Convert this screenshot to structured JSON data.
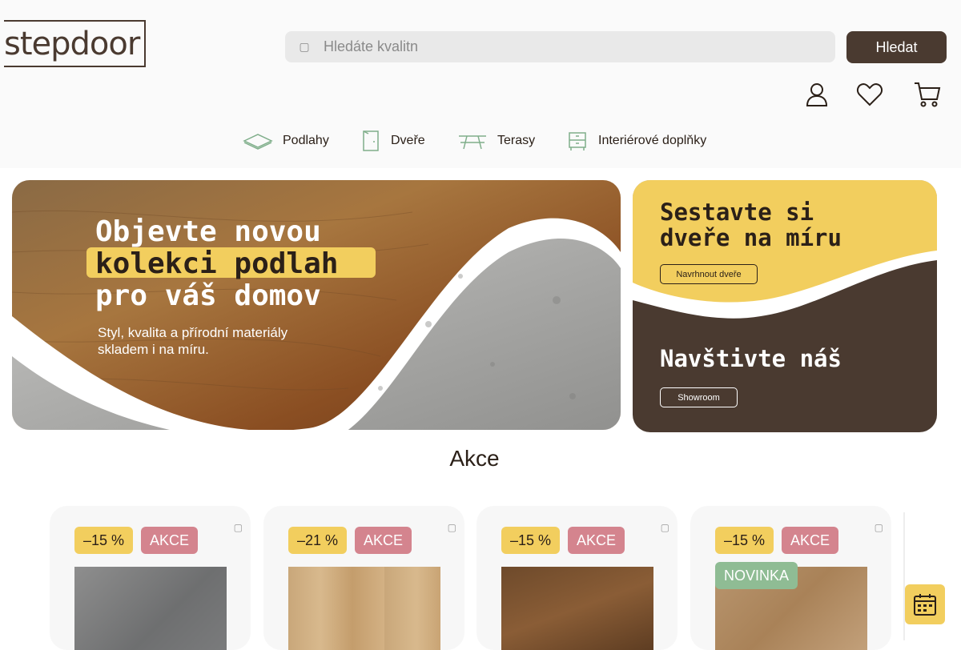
{
  "header": {
    "logo_text": "stepdoor",
    "search": {
      "placeholder": "Hledáte kvalitn",
      "icon": "search-icon"
    },
    "search_button": "Hledat",
    "icons": [
      "user-icon",
      "heart-icon",
      "cart-icon"
    ]
  },
  "nav": [
    {
      "label": "Podlahy",
      "icon": "floor-icon"
    },
    {
      "label": "Dveře",
      "icon": "door-icon"
    },
    {
      "label": "Terasy",
      "icon": "terrace-icon"
    },
    {
      "label": "Interiérové doplňky",
      "icon": "cabinet-icon"
    }
  ],
  "banner_left": {
    "line1": "Objevte novou",
    "line2": "kolekci podlah",
    "line3": "pro váš domov",
    "sub1": "Styl, kvalita a přírodní materiály",
    "sub2": "skladem i na míru."
  },
  "banner_right": {
    "top_line1": "Sestavte si",
    "top_line2": "dveře na míru",
    "top_button": "Navrhnout dveře",
    "bottom_title": "Navštivte náš",
    "bottom_button": "Showroom"
  },
  "section": {
    "title": "Akce"
  },
  "products": [
    {
      "discount": "–15 %",
      "tag": "AKCE",
      "extra": ""
    },
    {
      "discount": "–21 %",
      "tag": "AKCE",
      "extra": ""
    },
    {
      "discount": "–15 %",
      "tag": "AKCE",
      "extra": ""
    },
    {
      "discount": "–15 %",
      "tag": "AKCE",
      "extra": "NOVINKA"
    }
  ],
  "colors": {
    "brand_brown": "#4a3a30",
    "accent_yellow": "#f2ce5e",
    "akce_pink": "#d4848e",
    "novinka_green": "#8fbc94"
  }
}
